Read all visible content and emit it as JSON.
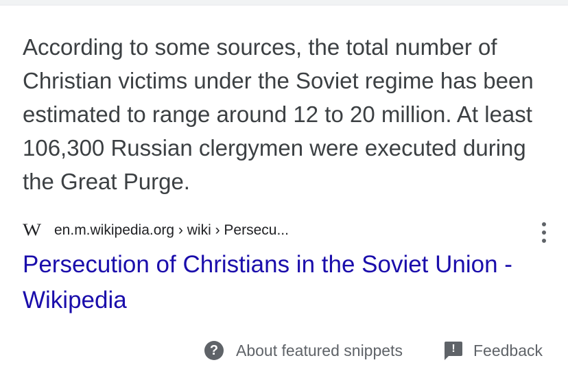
{
  "snippet": {
    "text": "According to some sources, the total number of Christian victims under the Soviet regime has been estimated to range around 12 to 20 million. At least 106,300 Russian clergymen were executed during the Great Purge."
  },
  "source": {
    "logo_letter": "W",
    "breadcrumb": "en.m.wikipedia.org › wiki › Persecu..."
  },
  "result": {
    "title": "Persecution of Christians in the Soviet Union - Wikipedia"
  },
  "footer": {
    "about_icon_glyph": "?",
    "about_label": "About featured snippets",
    "feedback_icon_glyph": "!",
    "feedback_label": "Feedback"
  },
  "icons": {
    "about": "help-circle-icon",
    "feedback": "feedback-icon",
    "more": "more-vert-icon",
    "source_logo": "wikipedia-logo-icon"
  },
  "colors": {
    "text": "#3c4043",
    "link": "#1a0dab",
    "muted": "#5f6368"
  }
}
